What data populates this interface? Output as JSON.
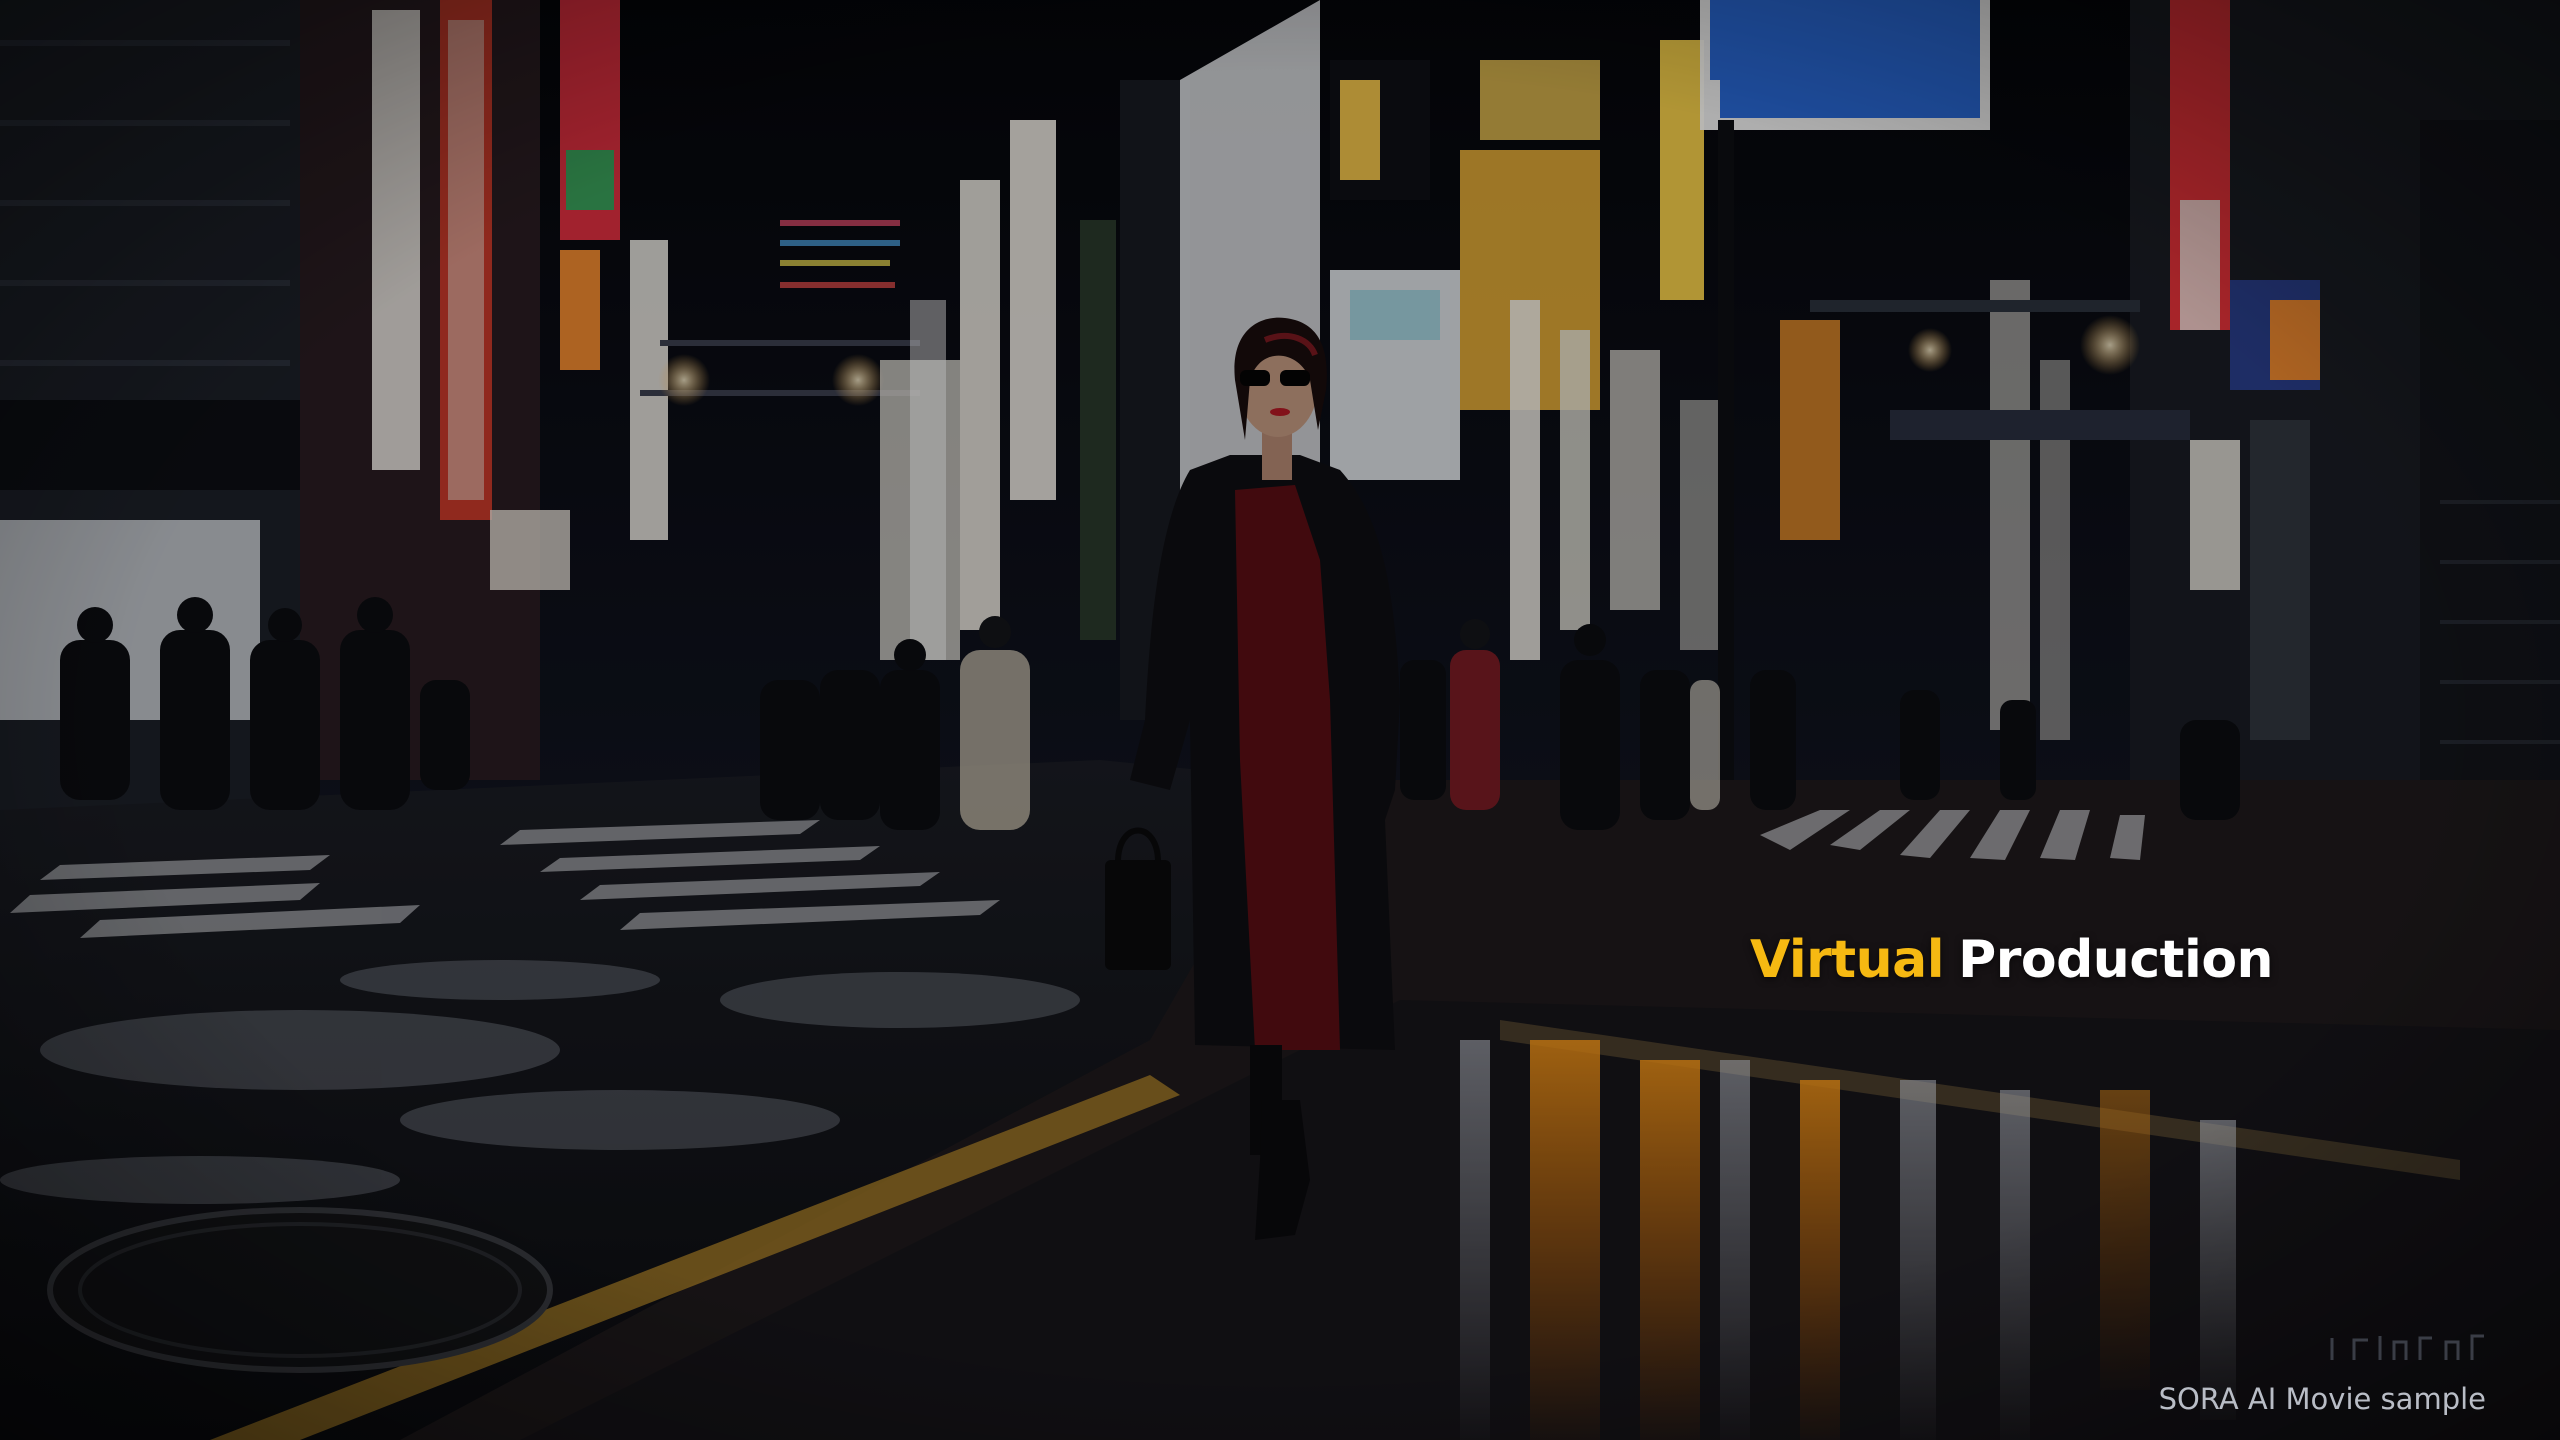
{
  "overlay": {
    "title_highlight": "Virtual",
    "title_rest": "Production",
    "caption": "SORA AI Movie sample"
  },
  "colors": {
    "highlight": "#f6b912",
    "title": "#ffffff",
    "caption": "#b9bdc6"
  },
  "scene": {
    "description_icons": [
      "neon-sign-icon",
      "street-lamp-icon",
      "manhole-icon"
    ]
  }
}
